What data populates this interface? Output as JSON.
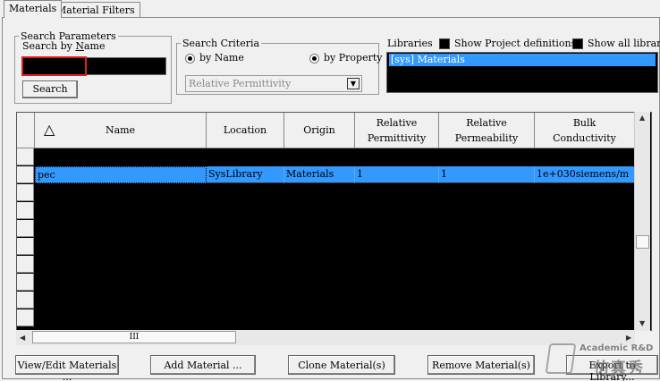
{
  "tabs": [
    "Materials",
    "Material Filters"
  ],
  "search": {
    "group_label": "Search Parameters",
    "name_label": "Search by Name",
    "name_value": "",
    "search_button": "Search"
  },
  "criteria": {
    "group_label": "Search Criteria",
    "by_name": "by Name",
    "by_property": "by Property",
    "property_selected": "Relative Permittivity"
  },
  "libraries": {
    "label": "Libraries",
    "show_project_defs": "Show Project definitions",
    "show_all_libraries": "Show all libraries",
    "items": [
      "[sys] Materials"
    ]
  },
  "grid": {
    "columns": [
      {
        "label": "Name"
      },
      {
        "label": "Location"
      },
      {
        "label": "Origin"
      },
      {
        "label": "Relative\nPermittivity"
      },
      {
        "label": "Relative\nPermeability"
      },
      {
        "label": "Bulk\nConductivity"
      }
    ],
    "rows": [
      [
        "pec",
        "SysLibrary",
        "Materials",
        "1",
        "1",
        "1e+030siemens/m"
      ]
    ],
    "sort_indicator": "△"
  },
  "scroll": {
    "hscroll_grip": "III"
  },
  "buttons": {
    "view_edit": "View/Edit Materials ...",
    "add": "Add Material ...",
    "clone": "Clone Material(s)",
    "remove": "Remove Material(s)",
    "export": "Export to Library..."
  },
  "watermark": {
    "line1": "Academic R&D",
    "line2": "仿真秀"
  },
  "colors": {
    "selection": "#3399ff",
    "highlight_border": "#e02020"
  }
}
